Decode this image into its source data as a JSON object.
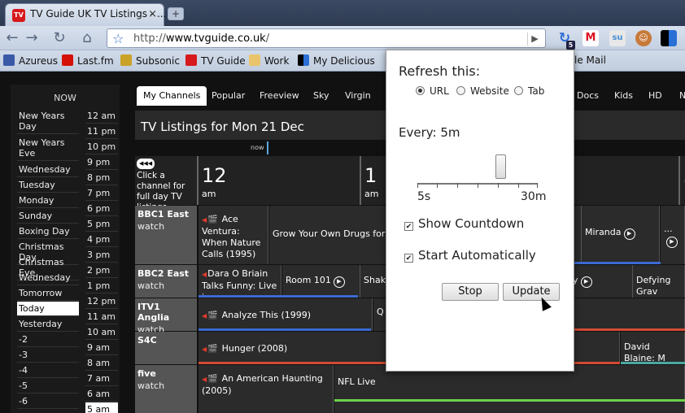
{
  "browser": {
    "tab_title": "TV Guide UK TV Listings - ...",
    "favicon_text": "TV",
    "close": "×",
    "new_tab": "+",
    "url_prefix": "http://",
    "url_host": "www.tvguide.co.uk",
    "url_path": "/"
  },
  "extensions": [
    "refresh-icon",
    "gmail-icon",
    "stumbleupon-icon",
    "monkey-icon",
    "delicious-icon"
  ],
  "extension_badge": "5",
  "bookmarks": [
    {
      "label": "Azureus",
      "icon": "azureus-icon"
    },
    {
      "label": "Last.fm",
      "icon": "lastfm-icon"
    },
    {
      "label": "Subsonic",
      "icon": "subsonic-icon"
    },
    {
      "label": "TV Guide",
      "icon": "tvguide-icon"
    },
    {
      "label": "Work",
      "icon": "folder-icon"
    },
    {
      "label": "My Delicious",
      "icon": "delicious-icon"
    },
    {
      "label": "le Mail",
      "icon": ""
    }
  ],
  "days": {
    "now": "NOW",
    "items": [
      "New Years Day",
      "New Years Eve",
      "Wednesday",
      "Tuesday",
      "Monday",
      "Sunday",
      "Boxing Day",
      "Christmas Day",
      "Christmas Eve",
      "Wednesday",
      "Tomorrow",
      "Today",
      "Yesterday",
      "-2",
      "-3",
      "-4",
      "-5",
      "-6"
    ],
    "hours": [
      "12 am",
      "11 pm",
      "10 pm",
      "9 pm",
      "8 pm",
      "7 pm",
      "6 pm",
      "5 pm",
      "4 pm",
      "3 pm",
      "2 pm",
      "1 pm",
      "12 pm",
      "11 am",
      "10 am",
      "9 am",
      "8 am",
      "7 am",
      "6 am",
      "5 am"
    ]
  },
  "channel_tabs": [
    "My Channels",
    "Popular",
    "Freeview",
    "Sky",
    "Virgin",
    "Docs",
    "Kids",
    "HD",
    "N"
  ],
  "listing_title": "TV Listings for Mon 21 Dec",
  "now_label": "now",
  "time_header": {
    "hint_arrow": "◀◀◀",
    "hint": "Click a channel for full day TV listings",
    "slots": [
      {
        "h": "12",
        "ap": "am"
      },
      {
        "h": "1",
        "ap": "am"
      },
      {
        "h": "3",
        "ap": ""
      }
    ]
  },
  "channels": [
    {
      "name": "BBC1 East",
      "watch": "watch",
      "programmes": [
        "Ace Ventura: When Nature Calls (1995)",
        "Grow Your Own Drugs for Ch",
        "Miranda",
        "..."
      ]
    },
    {
      "name": "BBC2 East",
      "watch": "watch",
      "programmes": [
        "Dara O Briain Talks Funny: Live in ...",
        "Room 101",
        "Shake",
        "y",
        "Defying Grav"
      ]
    },
    {
      "name": "ITV1 Anglia",
      "watch": "watch",
      "programmes": [
        "Analyze This (1999)",
        "Q"
      ]
    },
    {
      "name": "S4C",
      "watch": "watch",
      "programmes": [
        "Hunger (2008)",
        "David Blaine: M"
      ]
    },
    {
      "name": "five",
      "watch": "watch",
      "programmes": [
        "An American Haunting (2005)",
        "NFL Live"
      ]
    }
  ],
  "popup": {
    "heading": "Refresh this:",
    "options": [
      "URL",
      "Website",
      "Tab"
    ],
    "selected": "URL",
    "every": "Every: 5m",
    "slider_value_minutes": 5,
    "slider_min": "5s",
    "slider_max": "30m",
    "show_countdown": "Show Countdown",
    "start_auto": "Start Automatically",
    "stop": "Stop",
    "update": "Update"
  },
  "colors": {
    "bbc1_bar": "#3b6ad1",
    "bbc2_bar": "#3b6ad1",
    "itv_bar": "#d34b35",
    "s4c_bar": "#d34b35",
    "five_bar": "#6bd14a"
  }
}
